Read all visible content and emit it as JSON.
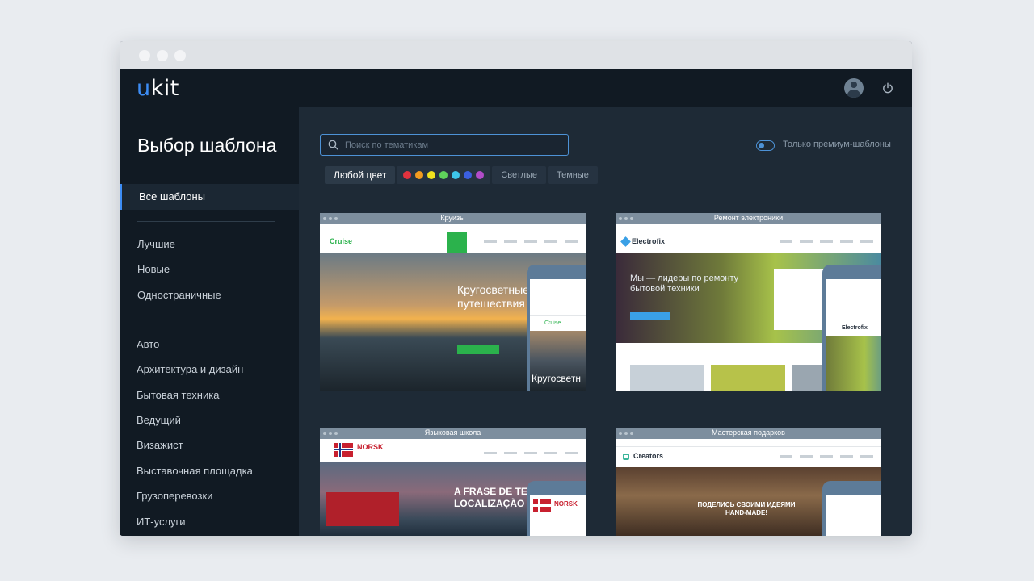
{
  "app": {
    "logo_u": "u",
    "logo_rest": "kit"
  },
  "sidebar": {
    "title": "Выбор шаблона",
    "active_item": "Все шаблоны",
    "groups": [
      "Лучшие",
      "Новые",
      "Одностраничные"
    ],
    "categories": [
      "Авто",
      "Архитектура и дизайн",
      "Бытовая техника",
      "Ведущий",
      "Визажист",
      "Выставочная площадка",
      "Грузоперевозки",
      "ИТ-услуги"
    ]
  },
  "search": {
    "placeholder": "Поиск по тематикам",
    "value": ""
  },
  "premium_toggle": {
    "label": "Только премиум-шаблоны",
    "on": false
  },
  "filters": {
    "any_color": "Любой цвет",
    "swatches": [
      "#e2323e",
      "#f39b1f",
      "#f2e21e",
      "#5fd35b",
      "#3ec6ea",
      "#3b5fe0",
      "#b24cc9"
    ],
    "light": "Светлые",
    "dark": "Темные"
  },
  "templates": [
    {
      "title": "Круизы",
      "brand": "Cruise",
      "hero": "Кругосветные путешествия",
      "phone_brand": "Cruise",
      "phone_hero": "Кругосветн",
      "accent": "#2bb24c"
    },
    {
      "title": "Ремонт электроники",
      "brand": "Electrofix",
      "hero": "Мы — лидеры по ремонту бытовой техники",
      "phone_brand": "Electrofix",
      "accent": "#3aa0e6"
    },
    {
      "title": "Языковая школа",
      "brand": "NORSK",
      "hero": "A FRASE DE TESTE LOCALIZAÇÃO BE",
      "phone_brand": "NORSK",
      "accent": "#c8202f"
    },
    {
      "title": "Мастерская подарков",
      "brand": "Creators",
      "hero": "ПОДЕЛИСЬ СВОИМИ ИДЕЯМИ HAND-MADE!",
      "accent": "#3ab59a"
    }
  ]
}
